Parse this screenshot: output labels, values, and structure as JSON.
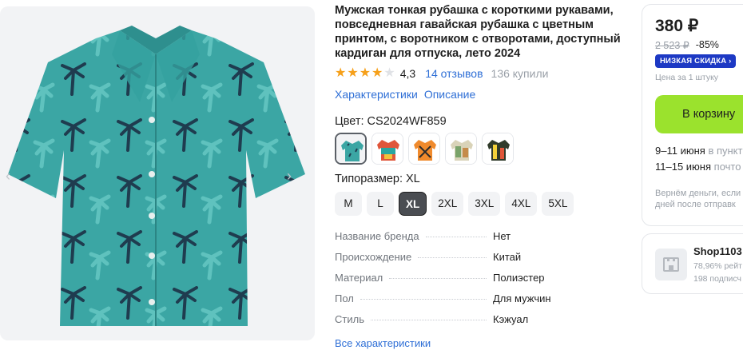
{
  "product": {
    "title": "Мужская тонкая рубашка с короткими рукавами, повседневная гавайская рубашка с цветным принтом, с воротником с отворотами, доступный кардиган для отпуска, лето 2024",
    "rating": "4,3",
    "reviews": "14 отзывов",
    "bought": "136 купили",
    "links": [
      "Характеристики",
      "Описание"
    ]
  },
  "color": {
    "label": "Цвет: CS2024WF859",
    "selected_index": 0
  },
  "size": {
    "label": "Типоразмер: XL",
    "options": [
      "M",
      "L",
      "XL",
      "2XL",
      "3XL",
      "4XL",
      "5XL"
    ],
    "selected": "XL"
  },
  "specs": [
    {
      "key": "Название бренда",
      "value": "Нет"
    },
    {
      "key": "Происхождение",
      "value": "Китай"
    },
    {
      "key": "Материал",
      "value": "Полиэстер"
    },
    {
      "key": "Пол",
      "value": "Для мужчин"
    },
    {
      "key": "Стиль",
      "value": "Кэжуал"
    }
  ],
  "all_specs_link": "Все характеристики",
  "price": {
    "current": "380 ₽",
    "old": "2 523 ₽",
    "discount": "-85%",
    "badge": "НИЗКАЯ СКИДКА ›",
    "per_unit": "Цена за 1 штуку",
    "cart_button": "В корзину",
    "delivery": [
      {
        "date": "9–11 июня",
        "place": "в пункт"
      },
      {
        "date": "11–15 июня",
        "place": "почто"
      }
    ],
    "refund": [
      "Вернём деньги, если",
      "дней после отправк"
    ]
  },
  "shop": {
    "name": "Shop1103",
    "rating": "78,96% рейт",
    "subscribers": "198 подписч"
  },
  "colors": {
    "accent_link": "#2f6fd6",
    "cart_green": "#9be22d",
    "badge_blue": "#1d39c4",
    "star": "#f6a01a"
  }
}
